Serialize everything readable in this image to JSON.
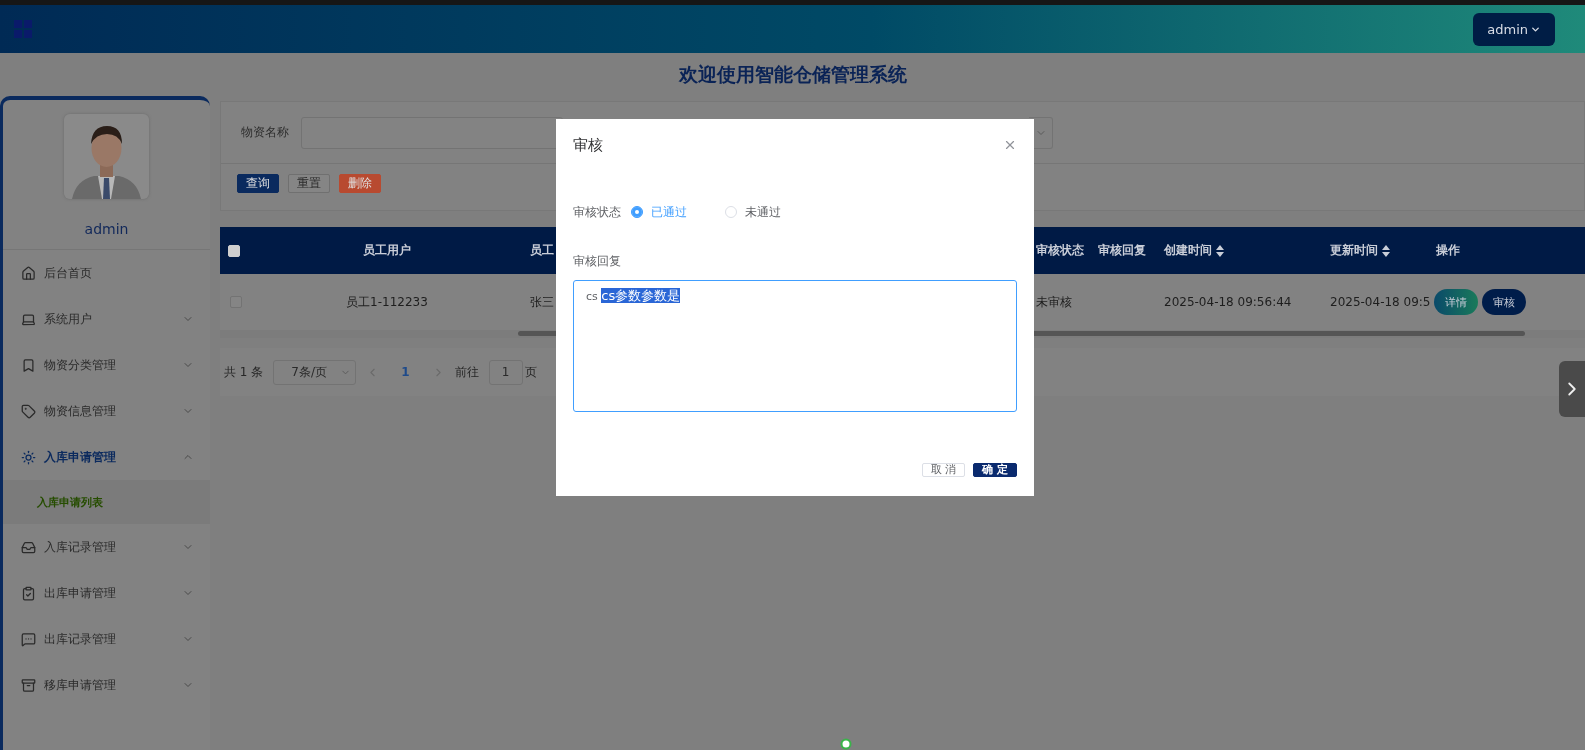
{
  "header": {
    "admin_menu": "admin"
  },
  "page_title": "欢迎使用智能仓储管理系统",
  "sidebar": {
    "user_name": "admin",
    "items": [
      {
        "label": "后台首页",
        "kind": "link"
      },
      {
        "label": "系统用户",
        "kind": "group",
        "expanded": false
      },
      {
        "label": "物资分类管理",
        "kind": "group",
        "expanded": false
      },
      {
        "label": "物资信息管理",
        "kind": "group",
        "expanded": false
      },
      {
        "label": "入库申请管理",
        "kind": "group",
        "expanded": true,
        "children": [
          {
            "label": "入库申请列表",
            "selected": true
          }
        ]
      },
      {
        "label": "入库记录管理",
        "kind": "group",
        "expanded": false
      },
      {
        "label": "出库申请管理",
        "kind": "group",
        "expanded": false
      },
      {
        "label": "出库记录管理",
        "kind": "group",
        "expanded": false
      },
      {
        "label": "移库申请管理",
        "kind": "group",
        "expanded": false
      }
    ]
  },
  "search": {
    "label": "物资名称",
    "buttons": [
      {
        "label": "查询",
        "kind": "primary"
      },
      {
        "label": "重置",
        "kind": "default"
      },
      {
        "label": "删除",
        "kind": "danger"
      }
    ]
  },
  "table": {
    "select_all_checked": false,
    "columns": [
      {
        "label": "员工用户"
      },
      {
        "label": "员工"
      },
      {
        "label": "审核状态"
      },
      {
        "label": "审核回复"
      },
      {
        "label": "创建时间",
        "sortable": true
      },
      {
        "label": "更新时间",
        "sortable": true
      },
      {
        "label": "操作"
      }
    ],
    "rows": [
      {
        "checked": false,
        "user": "员工1-112233",
        "name": "张三",
        "status": "未审核",
        "created": "2025-04-18 09:56:44",
        "updated": "2025-04-18 09:5",
        "actions": [
          {
            "label": "详情",
            "kind": "detail"
          },
          {
            "label": "审核",
            "kind": "review"
          }
        ]
      }
    ]
  },
  "pagination": {
    "total": "共 1 条",
    "page_size": "7条/页",
    "pages": [
      {
        "label": "1",
        "selected": true
      }
    ],
    "goto_label": "前往",
    "goto_value": "1",
    "page_suffix": "页"
  },
  "modal": {
    "title": "审核",
    "status_label": "审核状态",
    "options": [
      {
        "label": "已通过",
        "selected": true
      },
      {
        "label": "未通过",
        "selected": false
      }
    ],
    "reply_label": "审核回复",
    "reply_value": "cs ",
    "reply_selected": "cs参数参数是",
    "buttons": [
      {
        "label": "取 消",
        "kind": "default"
      },
      {
        "label": "确 定",
        "kind": "primary"
      }
    ]
  }
}
